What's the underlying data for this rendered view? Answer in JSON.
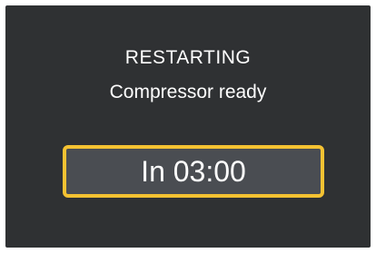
{
  "screen": {
    "title": "RESTARTING",
    "subtitle": "Compressor ready",
    "countdown": "In 03:00"
  },
  "colors": {
    "background": "#2f3133",
    "countdown_box": "#4a4d52",
    "highlight_border": "#f5c232",
    "text": "#ffffff"
  }
}
